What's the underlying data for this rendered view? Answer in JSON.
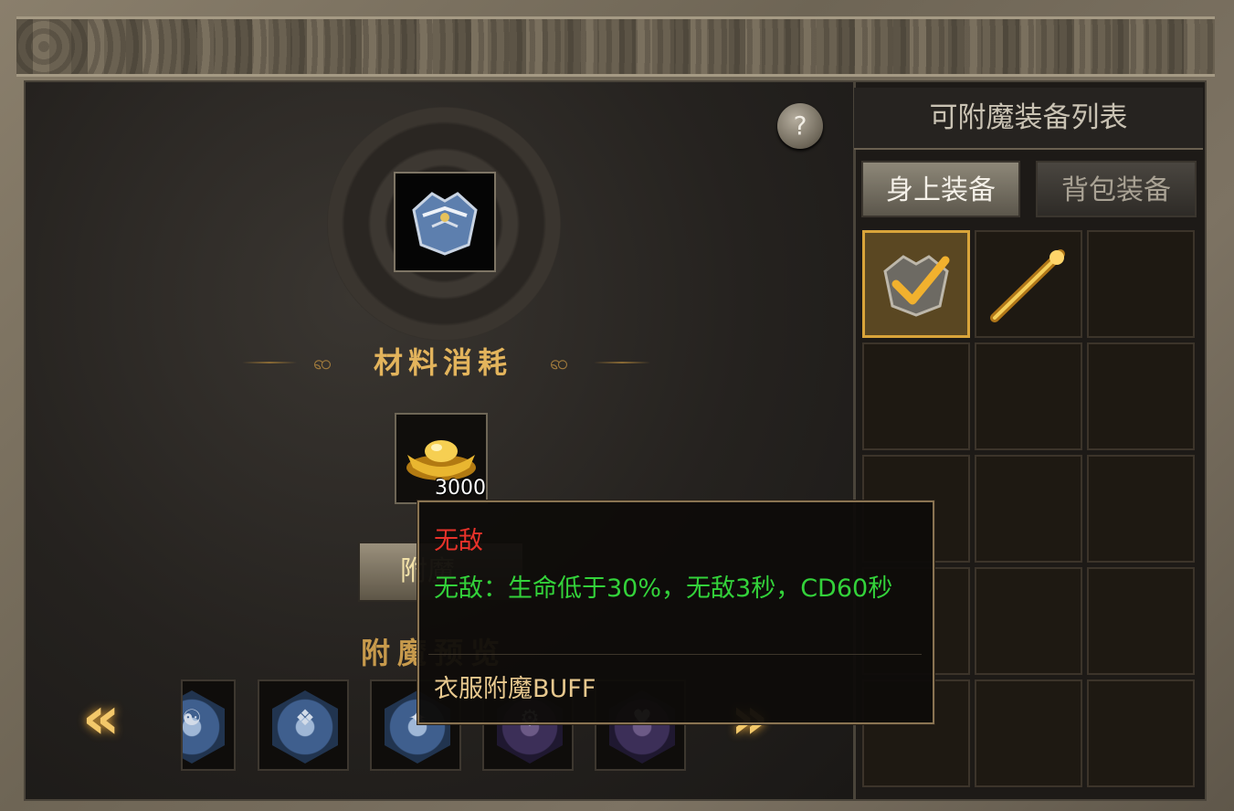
{
  "panel": {
    "list_title": "可附魔装备列表",
    "tabs": [
      {
        "label": "身上装备",
        "active": true
      },
      {
        "label": "背包装备",
        "active": false
      }
    ],
    "slots": [
      {
        "item": "armor",
        "selected": true
      },
      {
        "item": "golden-staff",
        "selected": false
      },
      {
        "item": null
      },
      {
        "item": null
      },
      {
        "item": null
      },
      {
        "item": null
      },
      {
        "item": null
      },
      {
        "item": null
      },
      {
        "item": null
      },
      {
        "item": null
      },
      {
        "item": null
      },
      {
        "item": null
      },
      {
        "item": null
      },
      {
        "item": null
      },
      {
        "item": null
      }
    ]
  },
  "enchant": {
    "help_label": "?",
    "materials_title": "材料消耗",
    "material_count": "3000",
    "enchant_button_label": "附魔",
    "preview_title": "附魔预览",
    "buffs": [
      {
        "color": "blue",
        "glyph": "☯"
      },
      {
        "color": "blue",
        "glyph": "❖"
      },
      {
        "color": "blue",
        "glyph": "✦"
      },
      {
        "color": "purple",
        "glyph": "⚙"
      },
      {
        "color": "purple",
        "glyph": "♥"
      }
    ]
  },
  "tooltip": {
    "name": "无敌",
    "description": "无敌：生命低于30%，无敌3秒，CD60秒",
    "footer": "衣服附魔BUFF"
  },
  "colors": {
    "accent_gold": "#e3b45c",
    "tooltip_name": "#e8322a",
    "tooltip_desc": "#33d23a",
    "tooltip_footer": "#e7c88e",
    "selected_border": "#d9a43a"
  }
}
